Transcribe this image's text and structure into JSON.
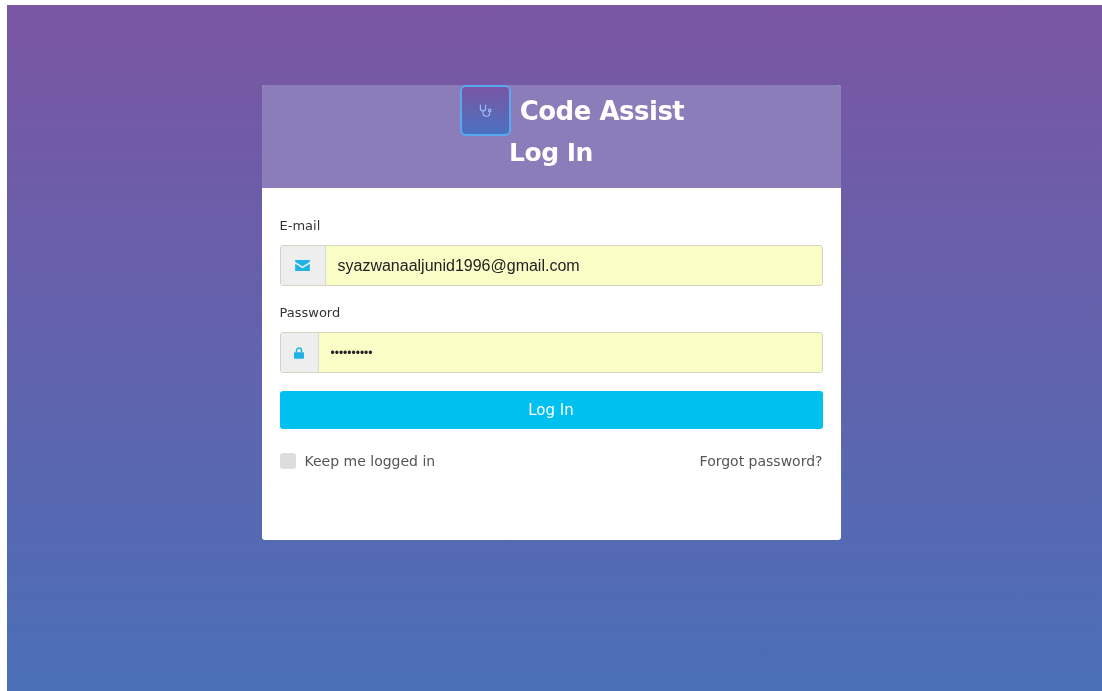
{
  "brand": {
    "name": "Code Assist"
  },
  "heading": "Log In",
  "fields": [
    {
      "kind": "email",
      "label": "E-mail",
      "value": "syazwanaaljunid1996@gmail.com"
    },
    {
      "kind": "password",
      "label": "Password",
      "value": "••••••••••"
    }
  ],
  "submit": "Log In",
  "remember": {
    "label": "Keep me logged in",
    "checked": false
  },
  "forgot": "Forgot password?"
}
